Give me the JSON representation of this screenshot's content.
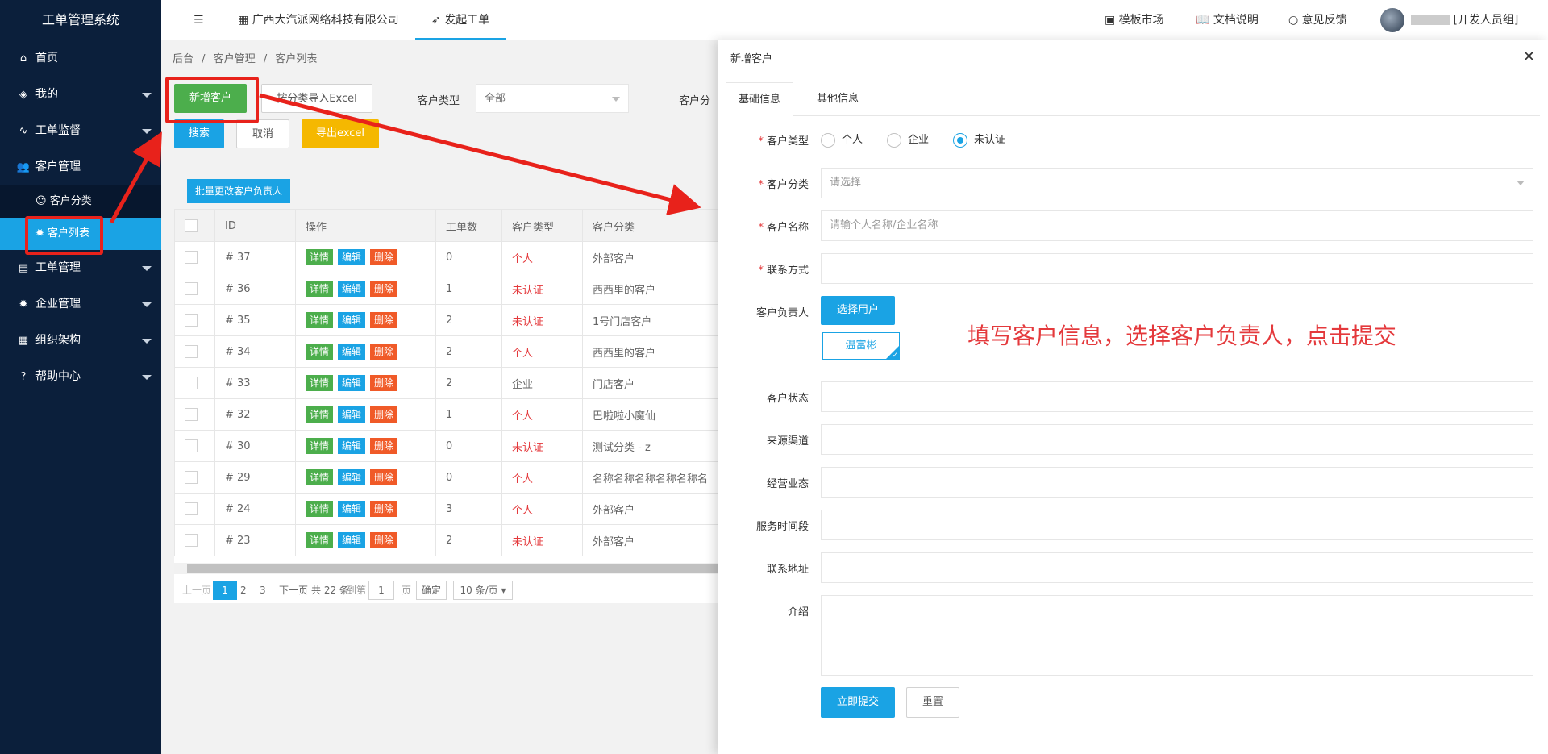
{
  "app": {
    "title": "工单管理系统"
  },
  "sidebar": {
    "items": [
      {
        "label": "首页",
        "icon": "home-icon"
      },
      {
        "label": "我的",
        "icon": "layers-icon"
      },
      {
        "label": "工单监督",
        "icon": "pulse-icon"
      },
      {
        "label": "客户管理",
        "icon": "users-icon"
      },
      {
        "label": "工单管理",
        "icon": "clipboard-icon"
      },
      {
        "label": "企业管理",
        "icon": "gear-icon"
      },
      {
        "label": "组织架构",
        "icon": "calendar-icon"
      },
      {
        "label": "帮助中心",
        "icon": "question-icon"
      }
    ],
    "sub": [
      {
        "label": "客户分类",
        "icon": "user-icon"
      },
      {
        "label": "客户列表",
        "icon": "gear-icon"
      }
    ]
  },
  "header": {
    "company": "广西大汽派网络科技有限公司",
    "launch": "发起工单",
    "template_market": "模板市场",
    "docs": "文档说明",
    "feedback": "意见反馈",
    "user": "[开发人员组]"
  },
  "breadcrumb": {
    "a": "后台",
    "b": "客户管理",
    "c": "客户列表",
    "sep": "/"
  },
  "toolbar": {
    "add": "新增客户",
    "import": "按分类导入Excel",
    "type_label": "客户类型",
    "type_value": "全部",
    "category_label": "客户分",
    "search": "搜索",
    "cancel": "取消",
    "export": "导出excel",
    "batch": "批量更改客户负责人"
  },
  "table": {
    "headers": [
      "ID",
      "操作",
      "工单数",
      "客户类型",
      "客户分类"
    ],
    "actions": [
      "详情",
      "编辑",
      "删除"
    ],
    "rows": [
      {
        "id": "# 37",
        "orders": "0",
        "type": "个人",
        "red": true,
        "category": "外部客户"
      },
      {
        "id": "# 36",
        "orders": "1",
        "type": "未认证",
        "red": true,
        "category": "西西里的客户"
      },
      {
        "id": "# 35",
        "orders": "2",
        "type": "未认证",
        "red": true,
        "category": "1号门店客户"
      },
      {
        "id": "# 34",
        "orders": "2",
        "type": "个人",
        "red": true,
        "category": "西西里的客户"
      },
      {
        "id": "# 33",
        "orders": "2",
        "type": "企业",
        "red": false,
        "category": "门店客户"
      },
      {
        "id": "# 32",
        "orders": "1",
        "type": "个人",
        "red": true,
        "category": "巴啦啦小魔仙"
      },
      {
        "id": "# 30",
        "orders": "0",
        "type": "未认证",
        "red": true,
        "category": "测试分类 - z"
      },
      {
        "id": "# 29",
        "orders": "0",
        "type": "个人",
        "red": true,
        "category": "名称名称名称名称名称名"
      },
      {
        "id": "# 24",
        "orders": "3",
        "type": "个人",
        "red": true,
        "category": "外部客户"
      },
      {
        "id": "# 23",
        "orders": "2",
        "type": "未认证",
        "red": true,
        "category": "外部客户"
      }
    ]
  },
  "pager": {
    "prev": "上一页",
    "pages": [
      "1",
      "2",
      "3"
    ],
    "next": "下一页",
    "total": "共 22 条",
    "goto": "到第",
    "goto_value": "1",
    "page_unit": "页",
    "confirm": "确定",
    "per_page": "10 条/页 ▾"
  },
  "drawer": {
    "title": "新增客户",
    "tabs": [
      "基础信息",
      "其他信息"
    ],
    "type_label": "客户类型",
    "type_options": [
      "个人",
      "企业",
      "未认证"
    ],
    "category_label": "客户分类",
    "category_placeholder": "请选择",
    "name_label": "客户名称",
    "name_placeholder": "请输个人名称/企业名称",
    "contact_label": "联系方式",
    "owner_label": "客户负责人",
    "select_user": "选择用户",
    "selected_user": "温富彬",
    "status_label": "客户状态",
    "source_label": "来源渠道",
    "business_label": "经营业态",
    "service_label": "服务时间段",
    "address_label": "联系地址",
    "intro_label": "介绍",
    "submit": "立即提交",
    "reset": "重置",
    "annotation": "填写客户信息，选择客户负责人，点击提交"
  },
  "colors": {
    "sidebar": "#0b1f3b",
    "accent": "#1aa3e4",
    "green": "#4cae4c",
    "danger": "#f05a28",
    "annotation": "#e8221b"
  }
}
